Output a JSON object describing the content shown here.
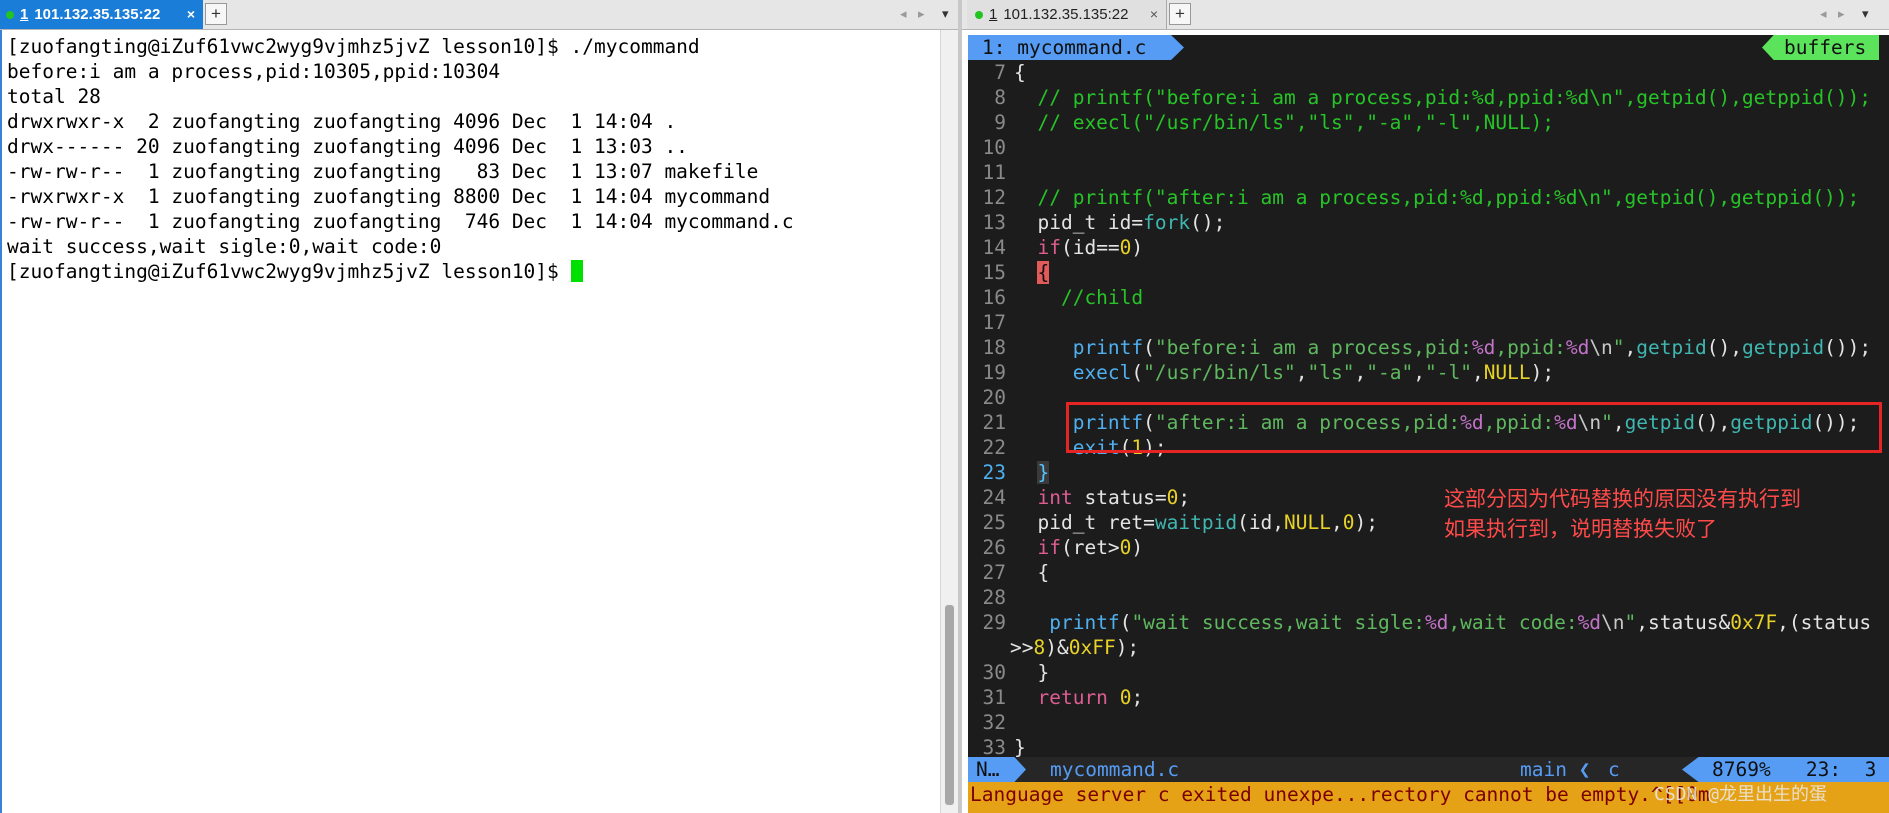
{
  "left_pane": {
    "tab": {
      "number": "1",
      "title": "101.132.35.135:22",
      "close": "×"
    },
    "new_tab": "+",
    "scroll_left": "◂",
    "scroll_right": "▸",
    "menu": "▾",
    "terminal_lines": [
      "[zuofangting@iZuf61vwc2wyg9vjmhz5jvZ lesson10]$ ./mycommand",
      "before:i am a process,pid:10305,ppid:10304",
      "total 28",
      "drwxrwxr-x  2 zuofangting zuofangting 4096 Dec  1 14:04 .",
      "drwx------ 20 zuofangting zuofangting 4096 Dec  1 13:03 ..",
      "-rw-rw-r--  1 zuofangting zuofangting   83 Dec  1 13:07 makefile",
      "-rwxrwxr-x  1 zuofangting zuofangting 8800 Dec  1 14:04 mycommand",
      "-rw-rw-r--  1 zuofangting zuofangting  746 Dec  1 14:04 mycommand.c",
      "wait success,wait sigle:0,wait code:0",
      "[zuofangting@iZuf61vwc2wyg9vjmhz5jvZ lesson10]$ "
    ]
  },
  "right_pane": {
    "tab": {
      "number": "1",
      "title": "101.132.35.135:22",
      "close": "×"
    },
    "new_tab": "+",
    "scroll_left": "◂",
    "scroll_right": "▸",
    "menu": "▾",
    "vim": {
      "tabline": {
        "active": "1: mycommand.c",
        "buffers": "buffers"
      },
      "code_lines": [
        {
          "n": "7",
          "tokens": [
            [
              "p",
              "{"
            ]
          ]
        },
        {
          "n": "8",
          "tokens": [
            [
              "com",
              "  // printf(\"before:i am a process,pid:%d,ppid:%d\\n\",getpid(),getppid());"
            ]
          ]
        },
        {
          "n": "9",
          "tokens": [
            [
              "com",
              "  // execl(\"/usr/bin/ls\",\"ls\",\"-a\",\"-l\",NULL);"
            ]
          ]
        },
        {
          "n": "10",
          "tokens": []
        },
        {
          "n": "11",
          "tokens": []
        },
        {
          "n": "12",
          "tokens": [
            [
              "com",
              "  // printf(\"after:i am a process,pid:%d,ppid:%d\\n\",getpid(),getppid());"
            ]
          ]
        },
        {
          "n": "13",
          "tokens": [
            [
              "p",
              "  pid_t id="
            ],
            [
              "fn",
              "fork"
            ],
            [
              "p",
              "();"
            ]
          ]
        },
        {
          "n": "14",
          "tokens": [
            [
              "p",
              "  "
            ],
            [
              "kw",
              "if"
            ],
            [
              "p",
              "(id=="
            ],
            [
              "num",
              "0"
            ],
            [
              "p",
              ")"
            ]
          ]
        },
        {
          "n": "15",
          "tokens": [
            [
              "p",
              "  "
            ],
            [
              "br",
              "{"
            ]
          ]
        },
        {
          "n": "16",
          "tokens": [
            [
              "com",
              "    //child"
            ]
          ]
        },
        {
          "n": "17",
          "tokens": []
        },
        {
          "n": "18",
          "tokens": [
            [
              "p",
              "     "
            ],
            [
              "fn2",
              "printf"
            ],
            [
              "p",
              "("
            ],
            [
              "str",
              "\"before:i am a process,pid:"
            ],
            [
              "fmt",
              "%d"
            ],
            [
              "str",
              ",ppid:"
            ],
            [
              "fmt",
              "%d"
            ],
            [
              "esc",
              "\\n"
            ],
            [
              "str",
              "\""
            ],
            [
              "p",
              ","
            ],
            [
              "fn",
              "getpid"
            ],
            [
              "p",
              "(),"
            ],
            [
              "fn",
              "getppid"
            ],
            [
              "p",
              "());"
            ]
          ]
        },
        {
          "n": "19",
          "tokens": [
            [
              "p",
              "     "
            ],
            [
              "fn2",
              "execl"
            ],
            [
              "p",
              "("
            ],
            [
              "str",
              "\"/usr/bin/ls\""
            ],
            [
              "p",
              ","
            ],
            [
              "str",
              "\"ls\""
            ],
            [
              "p",
              ","
            ],
            [
              "str",
              "\"-a\""
            ],
            [
              "p",
              ","
            ],
            [
              "str",
              "\"-l\""
            ],
            [
              "p",
              ","
            ],
            [
              "num",
              "NULL"
            ],
            [
              "p",
              ");"
            ]
          ]
        },
        {
          "n": "20",
          "tokens": []
        },
        {
          "n": "21",
          "tokens": [
            [
              "p",
              "     "
            ],
            [
              "fn2",
              "printf"
            ],
            [
              "p",
              "("
            ],
            [
              "str",
              "\"after:i am a process,pid:"
            ],
            [
              "fmt",
              "%d"
            ],
            [
              "str",
              ",ppid:"
            ],
            [
              "fmt",
              "%d"
            ],
            [
              "esc",
              "\\n"
            ],
            [
              "str",
              "\""
            ],
            [
              "p",
              ","
            ],
            [
              "fn",
              "getpid"
            ],
            [
              "p",
              "(),"
            ],
            [
              "fn",
              "getppid"
            ],
            [
              "p",
              "());"
            ]
          ]
        },
        {
          "n": "22",
          "tokens": [
            [
              "p",
              "     "
            ],
            [
              "fn2",
              "exit"
            ],
            [
              "p",
              "("
            ],
            [
              "num",
              "1"
            ],
            [
              "p",
              ");"
            ]
          ]
        },
        {
          "n": "23",
          "cur": true,
          "tokens": [
            [
              "p",
              "  "
            ],
            [
              "br2",
              "}"
            ]
          ]
        },
        {
          "n": "24",
          "tokens": [
            [
              "p",
              "  "
            ],
            [
              "kw",
              "int"
            ],
            [
              "p",
              " status="
            ],
            [
              "num",
              "0"
            ],
            [
              "p",
              ";"
            ]
          ]
        },
        {
          "n": "25",
          "tokens": [
            [
              "p",
              "  pid_t ret="
            ],
            [
              "fn",
              "waitpid"
            ],
            [
              "p",
              "(id,"
            ],
            [
              "num",
              "NULL"
            ],
            [
              "p",
              ","
            ],
            [
              "num",
              "0"
            ],
            [
              "p",
              ");"
            ]
          ]
        },
        {
          "n": "26",
          "tokens": [
            [
              "p",
              "  "
            ],
            [
              "kw",
              "if"
            ],
            [
              "p",
              "(ret>"
            ],
            [
              "num",
              "0"
            ],
            [
              "p",
              ")"
            ]
          ]
        },
        {
          "n": "27",
          "tokens": [
            [
              "p",
              "  {"
            ]
          ]
        },
        {
          "n": "28",
          "tokens": []
        },
        {
          "n": "29",
          "tokens": [
            [
              "p",
              "   "
            ],
            [
              "fn2",
              "printf"
            ],
            [
              "p",
              "("
            ],
            [
              "str",
              "\"wait success,wait sigle:"
            ],
            [
              "fmt",
              "%d"
            ],
            [
              "str",
              ",wait code:"
            ],
            [
              "fmt",
              "%d"
            ],
            [
              "esc",
              "\\n"
            ],
            [
              "str",
              "\""
            ],
            [
              "p",
              ",status&"
            ],
            [
              "num",
              "0x7F"
            ],
            [
              "p",
              ",(status"
            ]
          ]
        },
        {
          "n": "",
          "wrap": true,
          "tokens": [
            [
              "p",
              ">>"
            ],
            [
              "num",
              "8"
            ],
            [
              "p",
              ")&"
            ],
            [
              "num",
              "0xFF"
            ],
            [
              "p",
              ");"
            ]
          ]
        },
        {
          "n": "30",
          "tokens": [
            [
              "p",
              "  }"
            ]
          ]
        },
        {
          "n": "31",
          "tokens": [
            [
              "p",
              "  "
            ],
            [
              "kw",
              "return"
            ],
            [
              "p",
              " "
            ],
            [
              "num",
              "0"
            ],
            [
              "p",
              ";"
            ]
          ]
        },
        {
          "n": "32",
          "tokens": []
        },
        {
          "n": "33",
          "tokens": [
            [
              "p",
              "}"
            ]
          ]
        }
      ],
      "annotation": [
        "这部分因为代码替换的原因没有执行到",
        "如果执行到，说明替换失败了"
      ],
      "statusline": {
        "mode": "N…",
        "filename": "mycommand.c",
        "branch": "main ❮",
        "filetype": "c",
        "position": "8769%   23:  3"
      },
      "cmdline": "Language server c exited unexpe...rectory cannot be empty.^[[0m",
      "watermark": "CSDN @龙里出生的蛋"
    }
  },
  "colors": {
    "active_tab": "#1a7dd7",
    "vim_bg": "#1c1c1c",
    "vim_accent": "#569cf4",
    "buffers_tag": "#5be35b",
    "cmdline_bg": "#e5a217",
    "annotation": "#ff4a4a",
    "cursor": "#00e000"
  }
}
